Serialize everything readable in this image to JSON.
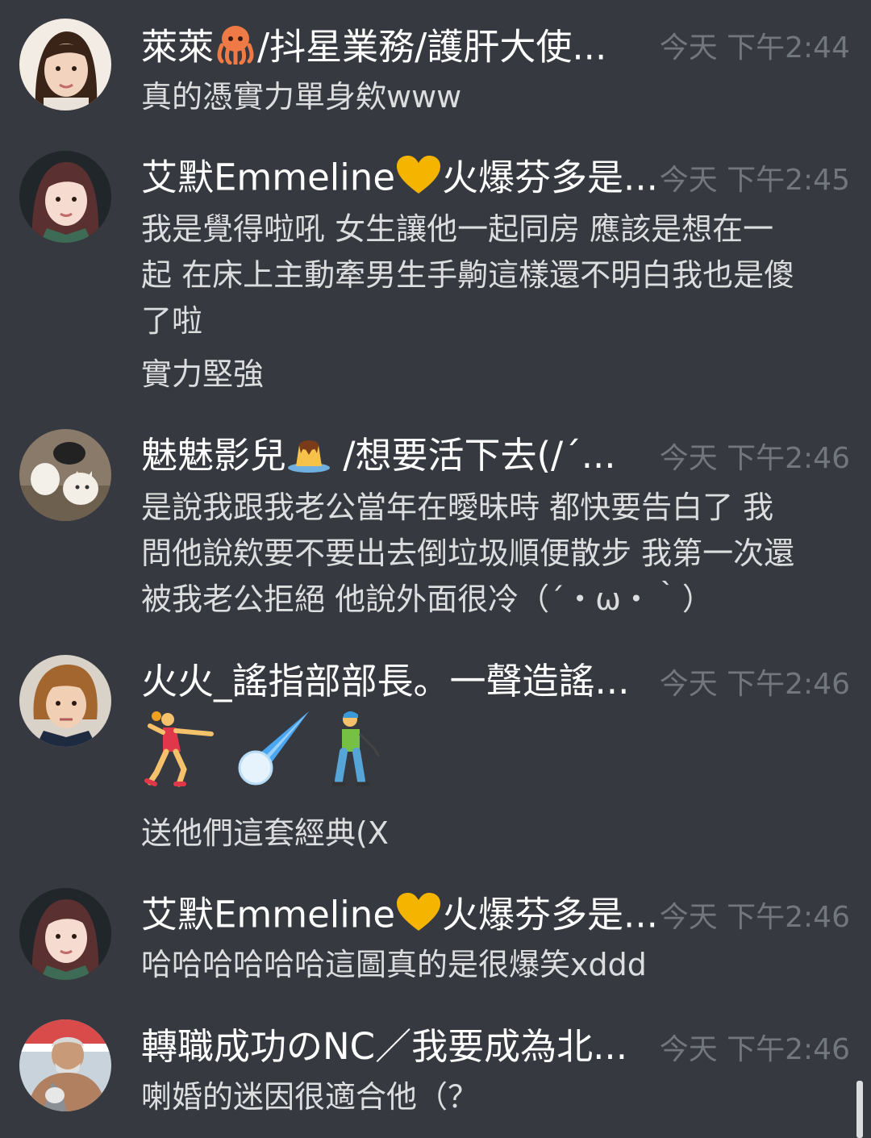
{
  "messages": [
    {
      "author": "萊萊",
      "author_rest": "/抖星業務/護肝大使...",
      "author_emoji": "octopus",
      "time": "今天 下午2:44",
      "lines": [
        "真的憑實力單身欸www"
      ]
    },
    {
      "author": "艾默Emmeline",
      "author_rest": "火爆芬多是...",
      "author_emoji": "yellow-heart",
      "time": "今天 下午2:45",
      "lines": [
        "我是覺得啦吼 女生讓他一起同房 應該是想在一",
        "起 在床上主動牽男生手齁這樣還不明白我也是傻",
        "了啦",
        "實力堅強"
      ]
    },
    {
      "author": "魅魅影兒",
      "author_rest": " /想要活下去(/´...",
      "author_emoji": "pudding",
      "time": "今天 下午2:46",
      "lines": [
        "是說我跟我老公當年在曖昧時 都快要告白了 我",
        "問他說欸要不要出去倒垃圾順便散步 我第一次還",
        "被我老公拒絕 他說外面很冷（´・ω・｀）"
      ]
    },
    {
      "author": "火火_謠指部部長。一聲造謠...",
      "author_rest": "",
      "author_emoji": "",
      "time": "今天 下午2:46",
      "emojis": [
        "woman-playing-handball",
        "comet",
        "person-golfing"
      ],
      "lines": [
        "送他們這套經典(X"
      ]
    },
    {
      "author": "艾默Emmeline",
      "author_rest": "火爆芬多是...",
      "author_emoji": "yellow-heart",
      "time": "今天 下午2:46",
      "lines": [
        "哈哈哈哈哈哈這圖真的是很爆笑xddd"
      ]
    },
    {
      "author": "轉職成功のNC／我要成為北...",
      "author_rest": "",
      "author_emoji": "",
      "time": "今天 下午2:46",
      "lines": [
        "喇婚的迷因很適合他（？"
      ]
    }
  ],
  "colors": {
    "background": "#36393f",
    "author": "#ffffff",
    "text": "#dcddde",
    "timestamp": "#72767d",
    "heart": "#f4b400"
  }
}
